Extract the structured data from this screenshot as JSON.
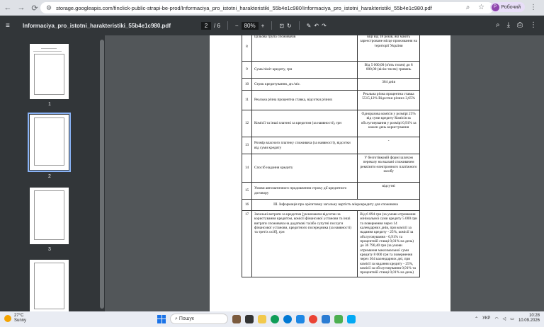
{
  "browser": {
    "url": "storage.googleapis.com/finclick-public-strapi-be-prod/Informaciya_pro_istotni_harakteristiki_55b4e1c980/Informaciya_pro_istotni_harakteristiki_55b4e1c980.pdf",
    "profile_label": "Робочий",
    "profile_initial": "Р"
  },
  "pdf": {
    "filename": "Informaciya_pro_istotni_harakteristiki_55b4e1c980.pdf",
    "current_page": "2",
    "total_pages": "/ 6",
    "zoom": "80%"
  },
  "thumbnails": [
    {
      "number": "1"
    },
    {
      "number": "2"
    },
    {
      "number": "3"
    }
  ],
  "table": {
    "row8": {
      "num": "8",
      "label": "Цільова група споживачів",
      "value": "віці від 18 років, які мають зареєстроване місце проживання на території України"
    },
    "row9": {
      "num": "9",
      "label": "Сума/ліміт кредиту, грн",
      "value": "Від 5 000,00 (п'ять тисяч) до 8 000,00 (вісім тисяч) гривень"
    },
    "row10": {
      "num": "10",
      "label": "Строк кредитування, дн./міс.",
      "value": "364 днів"
    },
    "row11": {
      "num": "11",
      "label": "Реальна річна процентна ставка, відсотки річних",
      "value": "Реальна річна процентна ставка 5515,12% Відсотки річних 3,65%"
    },
    "row12": {
      "num": "12",
      "label": "Комісії та інші платежі за кредитом (за наявності), грн",
      "value": "Одноразова комісія у розмірі 25% від суми кредиту Комісія за обслуговування у розмірі 0,91% за кожен день користування"
    },
    "row13": {
      "num": "13",
      "label": "Розмір власного платежу споживача (за наявності), відсотки від суми кредиту",
      "value": "-"
    },
    "row14": {
      "num": "14",
      "label": "Спосіб надання кредиту",
      "value": "У безготівковій формі шляхом переказу на вказані споживачем реквізити електронного платіжного засобу"
    },
    "row15": {
      "num": "15",
      "label": "Умови автоматичного продовження строку дії кредитного договору",
      "value": "відсутні"
    },
    "row16": {
      "num": "16",
      "section": "III. Інформація про орієнтовну загальну вартість мікрокредиту для споживача"
    },
    "row17": {
      "num": "17",
      "label": "Загальні витрати за кредитом [уключаючи відсотки за користування кредитом, комісії фінансової установи та інші витрати споживача на додаткові та/або супутні послуги фінансової установи, кредитного посередника (за наявності) та третіх осіб], грн",
      "value": "Від 6 894 грн (за умови отримання мінімальної суми кредиту 5 000 грн та повернення через 14 календарних днів, при комісії за надання кредиту - 25%, комісії за обслуговування - 0,91% та процентній ставці 0,01% на день) до 36 790,40 грн (за умови отримання максимальної суми кредиту 8 000 грн та повернення через 364 календарних дні, при комісії за надання кредиту - 25%, комісії за обслуговування 0,91% та процентній ставці 0,01% на день)"
    }
  },
  "taskbar": {
    "temperature": "27°C",
    "weather": "Sunny",
    "search_placeholder": "Пошук",
    "language": "УКР",
    "time": "10:28",
    "date": "10.09.2026"
  }
}
